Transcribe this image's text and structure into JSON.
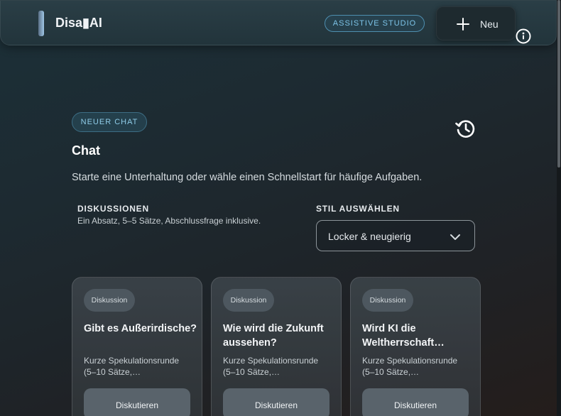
{
  "header": {
    "brand": "Disa▮AI",
    "studio_badge": "ASSISTIVE STUDIO",
    "new_label": "Neu"
  },
  "main": {
    "badge": "NEUER CHAT",
    "title": "Chat",
    "subtitle": "Starte eine Unterhaltung oder wähle einen Schnellstart für häufige Aufgaben.",
    "section_title": "DISKUSSIONEN",
    "section_desc": "Ein Absatz, 5–5 Sätze, Abschlussfrage inklusive.",
    "style_label": "STIL AUSWÄHLEN",
    "style_value": "Locker & neugierig"
  },
  "cards": [
    {
      "tag": "Diskussion",
      "title": "Gibt es Außerirdische?",
      "desc": "Kurze Spekulationsrunde (5–10 Sätze,…",
      "button": "Diskutieren"
    },
    {
      "tag": "Diskussion",
      "title": "Wie wird die Zukunft aussehen?",
      "desc": "Kurze Spekulationsrunde (5–10 Sätze,…",
      "button": "Diskutieren"
    },
    {
      "tag": "Diskussion",
      "title": "Wird KI die Weltherrschaft…",
      "desc": "Kurze Spekulationsrunde (5–10 Sätze,…",
      "button": "Diskutieren"
    }
  ],
  "icons": {
    "logo": "logo-bar-icon",
    "new": "plus-icon",
    "info": "info-icon",
    "history": "history-icon",
    "select": "chevron-down-icon"
  },
  "colors": {
    "accent": "#7dc3e8",
    "background": "#1d2a31"
  }
}
